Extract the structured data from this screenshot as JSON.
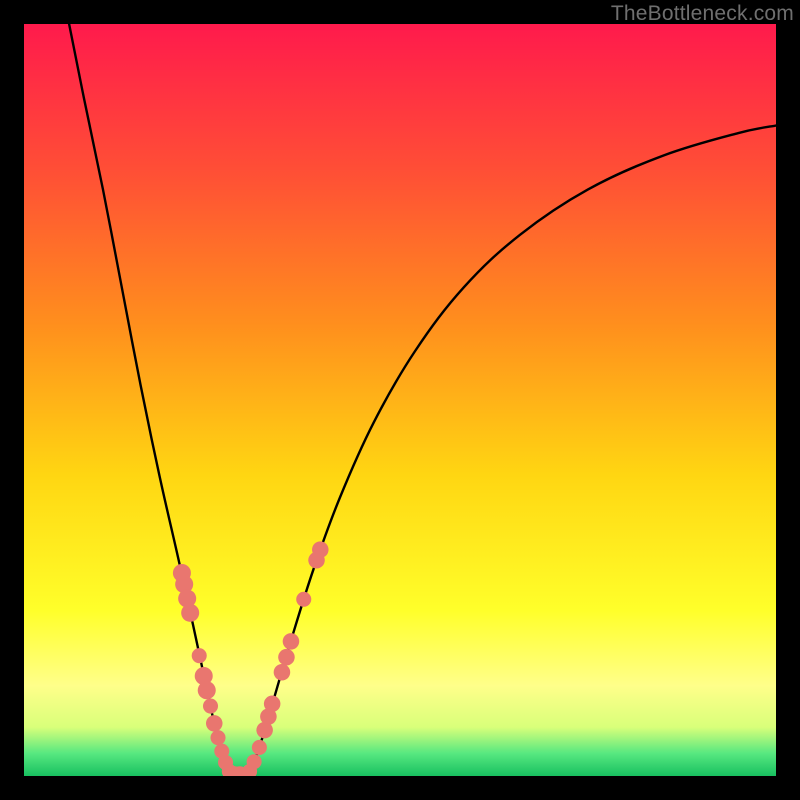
{
  "watermark": "TheBottleneck.com",
  "chart_data": {
    "type": "line",
    "title": "",
    "xlabel": "",
    "ylabel": "",
    "xlim": [
      0,
      100
    ],
    "ylim": [
      0,
      100
    ],
    "gradient_stops": [
      {
        "offset": 0.0,
        "color": "#ff1a4c"
      },
      {
        "offset": 0.2,
        "color": "#ff5035"
      },
      {
        "offset": 0.4,
        "color": "#ff8f1d"
      },
      {
        "offset": 0.6,
        "color": "#ffd612"
      },
      {
        "offset": 0.78,
        "color": "#ffff2a"
      },
      {
        "offset": 0.88,
        "color": "#ffff8a"
      },
      {
        "offset": 0.935,
        "color": "#d9ff7a"
      },
      {
        "offset": 0.97,
        "color": "#57e880"
      },
      {
        "offset": 1.0,
        "color": "#18c060"
      }
    ],
    "series": [
      {
        "name": "left-curve",
        "points": [
          {
            "x": 6.0,
            "y": 100.0
          },
          {
            "x": 8.0,
            "y": 90.0
          },
          {
            "x": 10.5,
            "y": 78.0
          },
          {
            "x": 13.0,
            "y": 65.0
          },
          {
            "x": 15.5,
            "y": 52.0
          },
          {
            "x": 18.0,
            "y": 40.0
          },
          {
            "x": 20.5,
            "y": 29.0
          },
          {
            "x": 22.5,
            "y": 20.0
          },
          {
            "x": 24.0,
            "y": 13.0
          },
          {
            "x": 25.3,
            "y": 7.0
          },
          {
            "x": 26.3,
            "y": 3.0
          },
          {
            "x": 27.3,
            "y": 0.5
          }
        ]
      },
      {
        "name": "right-curve",
        "points": [
          {
            "x": 30.0,
            "y": 0.5
          },
          {
            "x": 31.2,
            "y": 3.5
          },
          {
            "x": 33.0,
            "y": 9.5
          },
          {
            "x": 35.5,
            "y": 18.0
          },
          {
            "x": 38.5,
            "y": 27.5
          },
          {
            "x": 42.0,
            "y": 37.0
          },
          {
            "x": 46.5,
            "y": 47.0
          },
          {
            "x": 52.0,
            "y": 56.5
          },
          {
            "x": 58.5,
            "y": 65.0
          },
          {
            "x": 66.0,
            "y": 72.0
          },
          {
            "x": 75.0,
            "y": 78.0
          },
          {
            "x": 85.0,
            "y": 82.5
          },
          {
            "x": 95.0,
            "y": 85.5
          },
          {
            "x": 100.0,
            "y": 86.5
          }
        ]
      }
    ],
    "markers": [
      {
        "curve": "left",
        "x": 21.0,
        "y": 27.0,
        "r": 1.2
      },
      {
        "curve": "left",
        "x": 21.3,
        "y": 25.5,
        "r": 1.2
      },
      {
        "curve": "left",
        "x": 21.7,
        "y": 23.6,
        "r": 1.2
      },
      {
        "curve": "left",
        "x": 22.1,
        "y": 21.7,
        "r": 1.2
      },
      {
        "curve": "left",
        "x": 23.3,
        "y": 16.0,
        "r": 1.0
      },
      {
        "curve": "left",
        "x": 23.9,
        "y": 13.3,
        "r": 1.2
      },
      {
        "curve": "left",
        "x": 24.3,
        "y": 11.4,
        "r": 1.2
      },
      {
        "curve": "left",
        "x": 24.8,
        "y": 9.3,
        "r": 1.0
      },
      {
        "curve": "left",
        "x": 25.3,
        "y": 7.0,
        "r": 1.1
      },
      {
        "curve": "left",
        "x": 25.8,
        "y": 5.1,
        "r": 1.0
      },
      {
        "curve": "left",
        "x": 26.3,
        "y": 3.3,
        "r": 1.0
      },
      {
        "curve": "left",
        "x": 26.8,
        "y": 1.8,
        "r": 1.0
      },
      {
        "curve": "left",
        "x": 27.3,
        "y": 0.6,
        "r": 1.0
      },
      {
        "curve": "left",
        "x": 28.0,
        "y": 0.3,
        "r": 1.0
      },
      {
        "curve": "left",
        "x": 28.7,
        "y": 0.3,
        "r": 1.0
      },
      {
        "curve": "right",
        "x": 30.0,
        "y": 0.6,
        "r": 1.0
      },
      {
        "curve": "right",
        "x": 30.6,
        "y": 1.9,
        "r": 1.0
      },
      {
        "curve": "right",
        "x": 31.3,
        "y": 3.8,
        "r": 1.0
      },
      {
        "curve": "right",
        "x": 32.0,
        "y": 6.1,
        "r": 1.1
      },
      {
        "curve": "right",
        "x": 32.5,
        "y": 7.9,
        "r": 1.1
      },
      {
        "curve": "right",
        "x": 33.0,
        "y": 9.6,
        "r": 1.1
      },
      {
        "curve": "right",
        "x": 34.3,
        "y": 13.8,
        "r": 1.1
      },
      {
        "curve": "right",
        "x": 34.9,
        "y": 15.8,
        "r": 1.1
      },
      {
        "curve": "right",
        "x": 35.5,
        "y": 17.9,
        "r": 1.1
      },
      {
        "curve": "right",
        "x": 37.2,
        "y": 23.5,
        "r": 1.0
      },
      {
        "curve": "right",
        "x": 38.9,
        "y": 28.7,
        "r": 1.1
      },
      {
        "curve": "right",
        "x": 39.4,
        "y": 30.1,
        "r": 1.1
      }
    ]
  }
}
